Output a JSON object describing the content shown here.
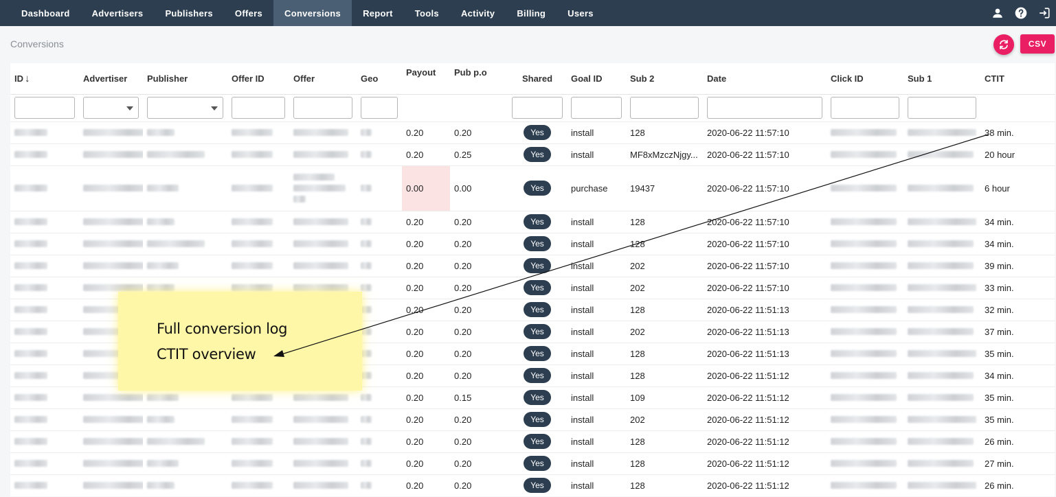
{
  "nav": {
    "items": [
      "Dashboard",
      "Advertisers",
      "Publishers",
      "Offers",
      "Conversions",
      "Report",
      "Tools",
      "Activity",
      "Billing",
      "Users"
    ],
    "active": "Conversions",
    "icons": [
      "user-icon",
      "help-icon",
      "logout-icon"
    ]
  },
  "page": {
    "title": "Conversions",
    "csv_label": "CSV",
    "accent_color": "#e91e63",
    "nav_color": "#2c3e50"
  },
  "table": {
    "headers": {
      "id": "ID",
      "advertiser": "Advertiser",
      "publisher": "Publisher",
      "offer_id": "Offer ID",
      "offer": "Offer",
      "geo": "Geo",
      "payout": "Payout",
      "pub_po": "Pub p.o",
      "shared": "Shared",
      "goal_id": "Goal ID",
      "sub2": "Sub 2",
      "date": "Date",
      "click_id": "Click ID",
      "sub1": "Sub 1",
      "ctit": "CTIT"
    },
    "sort_indicator": "↓",
    "rows": [
      {
        "payout": "0.20",
        "pub_po": "0.20",
        "shared": "Yes",
        "goal_id": "install",
        "sub2": "128",
        "date": "2020-06-22 11:57:10",
        "ctit": "38 min.",
        "ctit_status": "green"
      },
      {
        "payout": "0.20",
        "pub_po": "0.25",
        "shared": "Yes",
        "goal_id": "install",
        "sub2": "MF8xMzczNjgy...",
        "date": "2020-06-22 11:57:10",
        "ctit": "20 hour",
        "ctit_status": "orange"
      },
      {
        "payout": "0.00",
        "pub_po": "0.00",
        "shared": "Yes",
        "goal_id": "purchase",
        "sub2": "19437",
        "date": "2020-06-22 11:57:10",
        "ctit": "6 hour",
        "ctit_status": "dark",
        "tall": true,
        "payout_flag": "red"
      },
      {
        "payout": "0.20",
        "pub_po": "0.20",
        "shared": "Yes",
        "goal_id": "install",
        "sub2": "128",
        "date": "2020-06-22 11:57:10",
        "ctit": "34 min.",
        "ctit_status": "green"
      },
      {
        "payout": "0.20",
        "pub_po": "0.20",
        "shared": "Yes",
        "goal_id": "install",
        "sub2": "128",
        "date": "2020-06-22 11:57:10",
        "ctit": "34 min.",
        "ctit_status": "green"
      },
      {
        "payout": "0.20",
        "pub_po": "0.20",
        "shared": "Yes",
        "goal_id": "install",
        "sub2": "202",
        "date": "2020-06-22 11:57:10",
        "ctit": "39 min.",
        "ctit_status": "green"
      },
      {
        "payout": "0.20",
        "pub_po": "0.20",
        "shared": "Yes",
        "goal_id": "install",
        "sub2": "202",
        "date": "2020-06-22 11:57:10",
        "ctit": "33 min.",
        "ctit_status": "green"
      },
      {
        "payout": "0.20",
        "pub_po": "0.20",
        "shared": "Yes",
        "goal_id": "install",
        "sub2": "128",
        "date": "2020-06-22 11:51:13",
        "ctit": "32 min.",
        "ctit_status": "green"
      },
      {
        "payout": "0.20",
        "pub_po": "0.20",
        "shared": "Yes",
        "goal_id": "install",
        "sub2": "202",
        "date": "2020-06-22 11:51:13",
        "ctit": "37 min.",
        "ctit_status": "green"
      },
      {
        "payout": "0.20",
        "pub_po": "0.20",
        "shared": "Yes",
        "goal_id": "install",
        "sub2": "128",
        "date": "2020-06-22 11:51:13",
        "ctit": "35 min.",
        "ctit_status": "green"
      },
      {
        "payout": "0.20",
        "pub_po": "0.20",
        "shared": "Yes",
        "goal_id": "install",
        "sub2": "128",
        "date": "2020-06-22 11:51:12",
        "ctit": "34 min.",
        "ctit_status": "green"
      },
      {
        "payout": "0.20",
        "pub_po": "0.15",
        "shared": "Yes",
        "goal_id": "install",
        "sub2": "109",
        "date": "2020-06-22 11:51:12",
        "ctit": "35 min.",
        "ctit_status": "green"
      },
      {
        "payout": "0.20",
        "pub_po": "0.20",
        "shared": "Yes",
        "goal_id": "install",
        "sub2": "202",
        "date": "2020-06-22 11:51:12",
        "ctit": "35 min.",
        "ctit_status": "green"
      },
      {
        "payout": "0.20",
        "pub_po": "0.20",
        "shared": "Yes",
        "goal_id": "install",
        "sub2": "128",
        "date": "2020-06-22 11:51:12",
        "ctit": "26 min.",
        "ctit_status": "green"
      },
      {
        "payout": "0.20",
        "pub_po": "0.20",
        "shared": "Yes",
        "goal_id": "install",
        "sub2": "128",
        "date": "2020-06-22 11:51:12",
        "ctit": "27 min.",
        "ctit_status": "green"
      },
      {
        "payout": "0.20",
        "pub_po": "0.20",
        "shared": "Yes",
        "goal_id": "install",
        "sub2": "128",
        "date": "2020-06-22 11:51:12",
        "ctit": "26 min.",
        "ctit_status": "green"
      }
    ]
  },
  "annotation": {
    "line1": "Full conversion log",
    "line2": "CTIT overview"
  }
}
